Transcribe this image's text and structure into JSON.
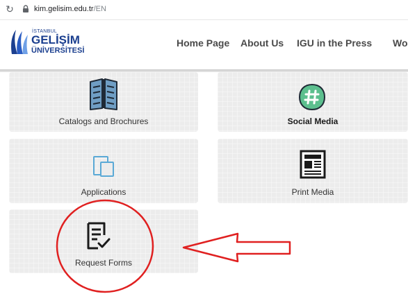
{
  "browser": {
    "url_host": "kim.gelisim.edu.tr",
    "url_path": "/EN"
  },
  "logo": {
    "line1": "İSTANBUL",
    "line2": "GELİŞİM",
    "line3": "ÜNİVERSİTESİ"
  },
  "nav": {
    "items": [
      "Home Page",
      "About Us",
      "IGU in the Press",
      "Worki"
    ]
  },
  "cards": [
    {
      "label": "Catalogs and Brochures",
      "icon": "book-icon"
    },
    {
      "label": "Social Media",
      "icon": "hashtag-icon"
    },
    {
      "label": "Applications",
      "icon": "tablet-icon"
    },
    {
      "label": "Print Media",
      "icon": "newspaper-icon"
    },
    {
      "label": "Request Forms",
      "icon": "form-check-icon"
    }
  ],
  "colors": {
    "brand_blue": "#1b3f8f",
    "card_bg": "#ececec",
    "annotation_red": "#e02020",
    "social_green": "#5cbf8e",
    "tablet_blue": "#5aa9d6"
  }
}
